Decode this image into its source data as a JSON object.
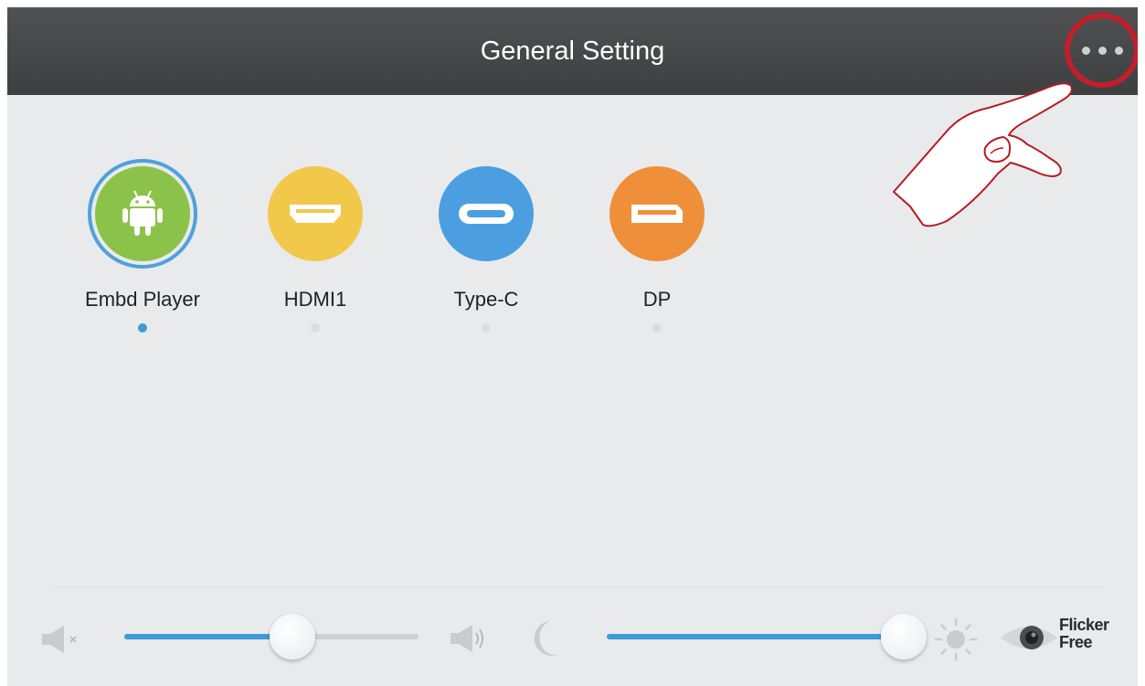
{
  "header": {
    "title": "General Setting",
    "menu_icon": "more-dots-icon"
  },
  "sources": [
    {
      "label": "Embd Player",
      "icon": "android-icon",
      "color": "#8bc34a",
      "selected": true
    },
    {
      "label": "HDMI1",
      "icon": "hdmi-port-icon",
      "color": "#f2c84b",
      "selected": false
    },
    {
      "label": "Type-C",
      "icon": "usb-c-port-icon",
      "color": "#4b9fe0",
      "selected": false
    },
    {
      "label": "DP",
      "icon": "displayport-icon",
      "color": "#ef8f3a",
      "selected": false
    }
  ],
  "controls": {
    "volume": {
      "level": 0.59,
      "min_icon": "mute-icon",
      "max_icon": "volume-icon"
    },
    "brightness": {
      "level": 1.0,
      "min_icon": "moon-icon",
      "max_icon": "sun-icon"
    },
    "badge": {
      "line1": "Flicker",
      "line2": "Free",
      "icon": "eye-icon"
    }
  },
  "colors": {
    "header_bg": "#47494b",
    "accent": "#3e9ad8",
    "highlight_ring": "#c21f2b",
    "background": "#e9eaec"
  }
}
